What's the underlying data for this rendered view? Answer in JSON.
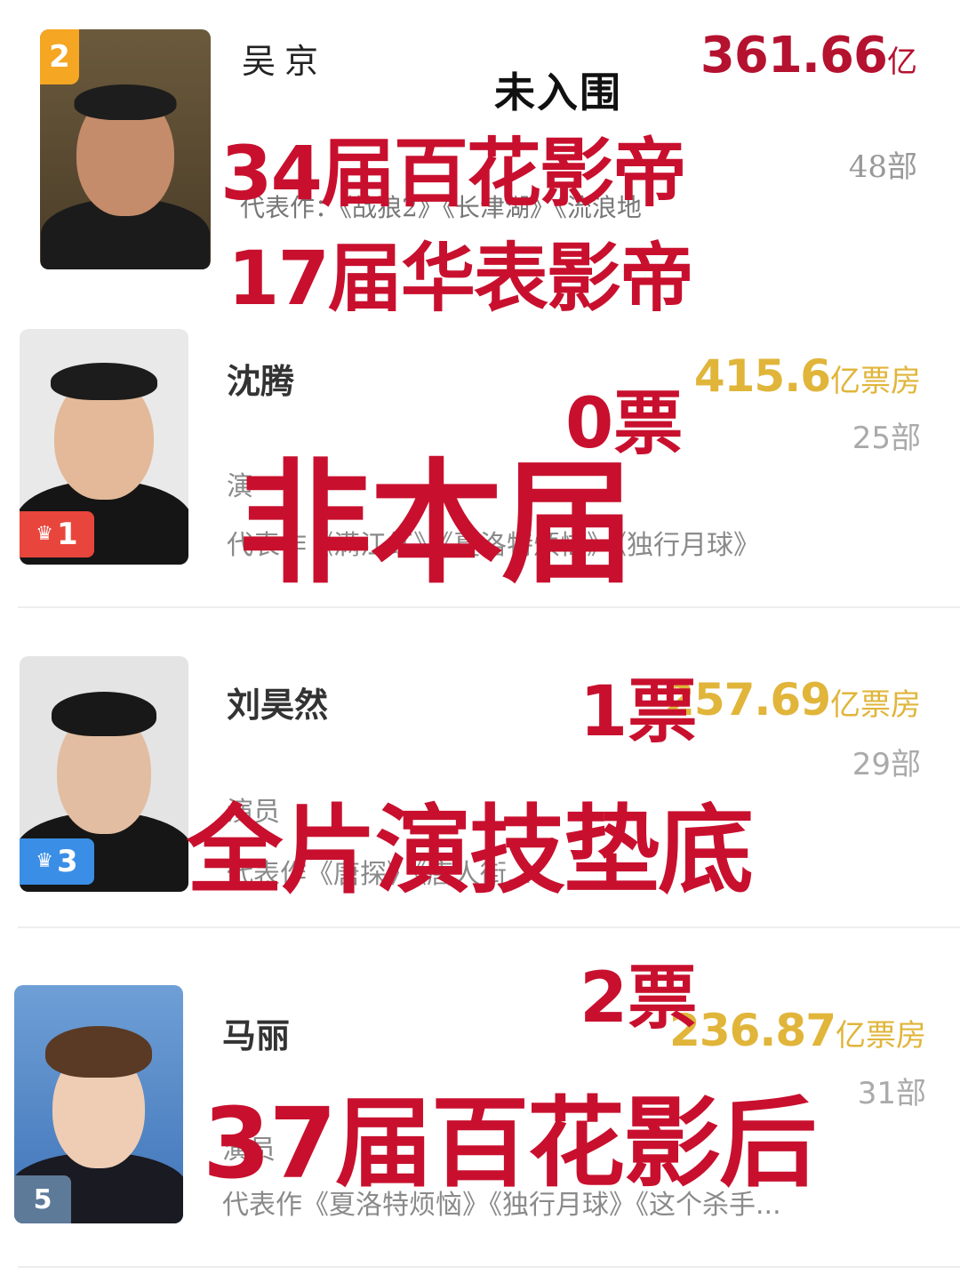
{
  "entries": [
    {
      "rank": "2",
      "name": "吴京",
      "gross_num": "361.66",
      "gross_unit": "亿",
      "count": "48部",
      "works": "代表作：《战狼2》《长津湖》《流浪地",
      "overlay_1": "34届百花影帝",
      "overlay_2": "17届华表影帝",
      "note": "未入围"
    },
    {
      "rank": "1",
      "name": "沈腾",
      "gross_num": "415.6",
      "gross_unit": "亿票房",
      "count": "25部",
      "roles": "演",
      "works": "代表作《满江红》《夏洛特烦恼》《独行月球》",
      "votes": "0票",
      "overlay": "非本届"
    },
    {
      "rank": "3",
      "name": "刘昊然",
      "gross_num": "257.69",
      "gross_unit": "亿票房",
      "count": "29部",
      "roles": "演员",
      "works": "代表作《唐探》《唐人街...",
      "votes": "1票",
      "overlay": "全片演技垫底"
    },
    {
      "rank": "5",
      "name": "马丽",
      "gross_num": "236.87",
      "gross_unit": "亿票房",
      "count": "31部",
      "roles": "演员",
      "works": "代表作《夏洛特烦恼》《独行月球》《这个杀手...",
      "votes": "2票",
      "overlay": "37届百花影后"
    }
  ],
  "colors": {
    "overlay_red": "#c8102e",
    "gross_red": "#b5122f",
    "gross_gold": "#e0b53a",
    "gray_text": "#8a8a8a",
    "badge_orange": "#f5a623",
    "badge_red": "#e8453c",
    "badge_blue": "#3a8ee6",
    "badge_slate": "#5d7a99"
  },
  "icons": [
    "crown-icon"
  ]
}
